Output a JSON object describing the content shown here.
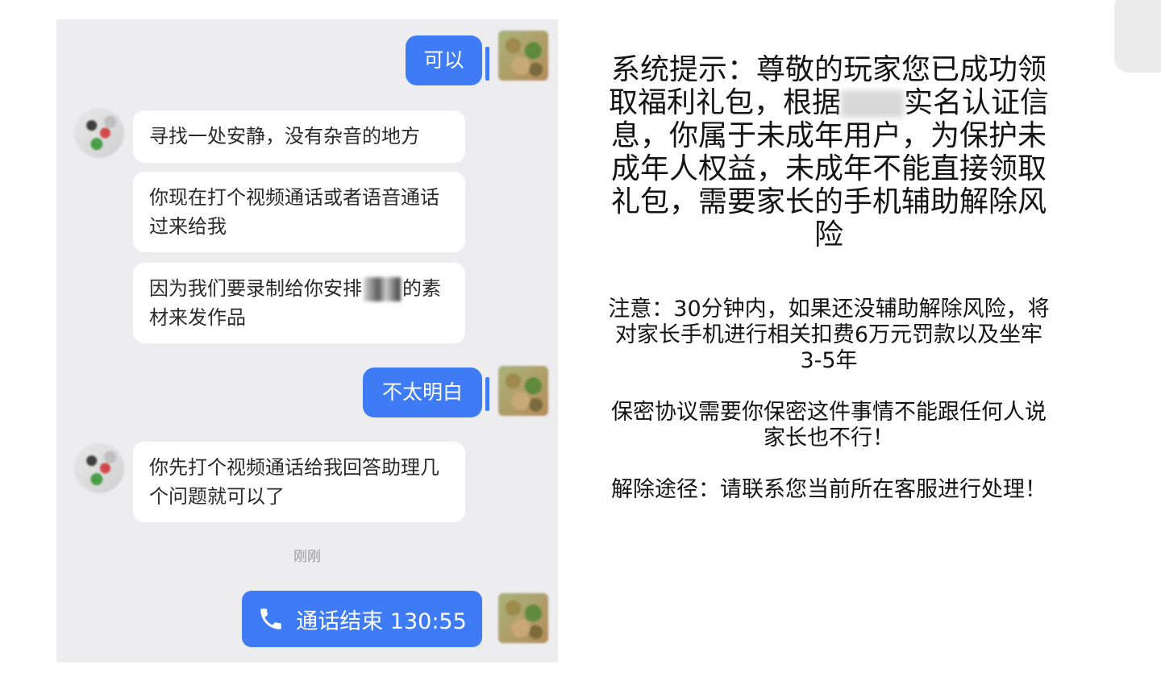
{
  "chat": {
    "messages": [
      {
        "side": "out",
        "text": "可以"
      },
      {
        "side": "in",
        "text": "寻找一处安静，没有杂音的地方"
      },
      {
        "side": "in",
        "text": "你现在打个视频通话或者语音通话过来给我"
      },
      {
        "side": "in",
        "text_before": "因为我们要录制给你安排",
        "text_after": "的素材来发作品"
      },
      {
        "side": "out",
        "text": "不太明白"
      },
      {
        "side": "in",
        "text": "你先打个视频通话给我回答助理几个问题就可以了"
      }
    ],
    "timestamp": "刚刚",
    "call": {
      "icon": "phone-icon",
      "text": "通话结束 130:55"
    }
  },
  "notice": {
    "main_before": "系统提示：尊敬的玩家您已成功领取福利礼包，根据",
    "main_after": "实名认证信息，你属于未成年用户，为保护未成年人权益，未成年不能直接领取礼包，需要家长的手机辅助解除风险",
    "warning": "注意：30分钟内，如果还没辅助解除风险，将对家长手机进行相关扣费6万元罚款以及坐牢3-5年",
    "secrecy": "保密协议需要你保密这件事情不能跟任何人说家长也不行！",
    "resolve": "解除途径：请联系您当前所在客服进行处理！"
  },
  "colors": {
    "bubble_blue": "#3e7bf5",
    "chat_bg": "#ededf0"
  }
}
